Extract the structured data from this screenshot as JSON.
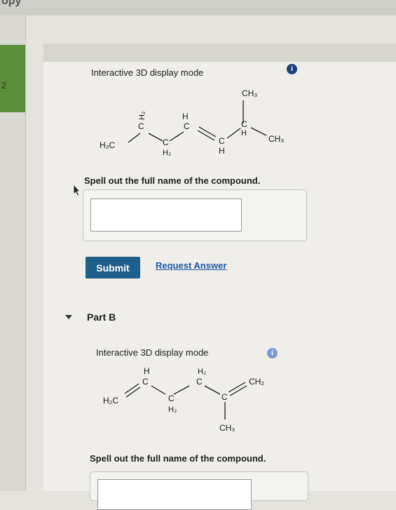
{
  "header": {
    "corner_text": "opy"
  },
  "sidebar": {
    "question_number": "2"
  },
  "part_a": {
    "display_mode_label": "Interactive 3D display mode",
    "question": "Spell out the full name of the compound.",
    "answer_value": "",
    "submit_label": "Submit",
    "request_answer_label": "Request Answer",
    "structure_labels": {
      "ch3_top": "CH₃",
      "h2_left": "H₂",
      "h_mid": "H",
      "c1": "C",
      "c2": "C",
      "c3": "C",
      "c4": "C",
      "c5": "C",
      "h3c": "H₃C",
      "h2_bottom": "H₂",
      "h_bottom": "H",
      "h_right": "H",
      "ch3_right": "CH₃"
    }
  },
  "part_b": {
    "title": "Part B",
    "display_mode_label": "Interactive 3D display mode",
    "question": "Spell out the full name of the compound.",
    "answer_value": "",
    "structure_labels": {
      "h_top": "H",
      "h2_top": "H₂",
      "c1": "C",
      "c2": "C",
      "c3": "C",
      "c4": "C",
      "h2c": "H₂C",
      "h2_bottom": "H₂",
      "ch2_right": "CH₂",
      "ch3_bottom": "CH₃"
    }
  },
  "colors": {
    "submit": "#1f5f8b",
    "link": "#1c58a8",
    "info_dark": "#1d3f7a",
    "info_light": "#7f9ad0",
    "accent": "#5b8f3a"
  }
}
